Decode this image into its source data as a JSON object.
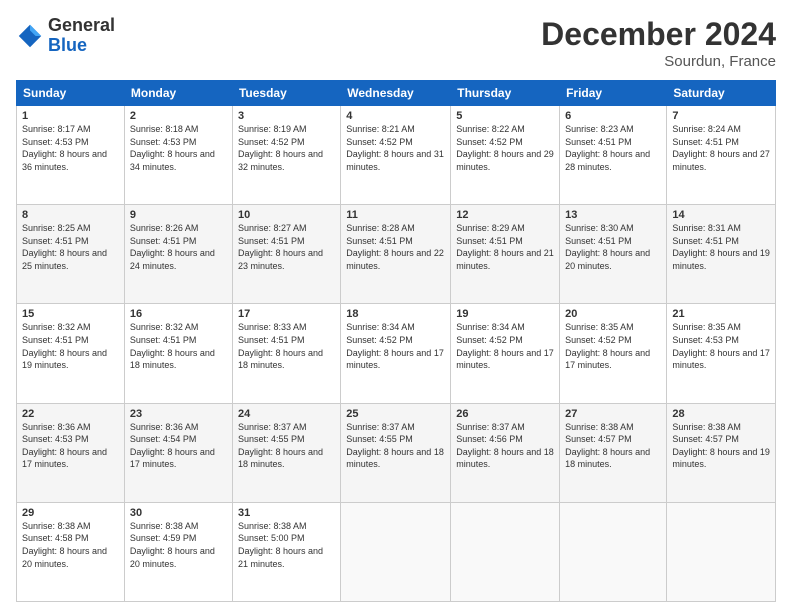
{
  "logo": {
    "general": "General",
    "blue": "Blue"
  },
  "title": "December 2024",
  "subtitle": "Sourdun, France",
  "calendar": {
    "headers": [
      "Sunday",
      "Monday",
      "Tuesday",
      "Wednesday",
      "Thursday",
      "Friday",
      "Saturday"
    ],
    "weeks": [
      [
        {
          "day": "1",
          "sunrise": "8:17 AM",
          "sunset": "4:53 PM",
          "daylight": "8 hours and 36 minutes."
        },
        {
          "day": "2",
          "sunrise": "8:18 AM",
          "sunset": "4:53 PM",
          "daylight": "8 hours and 34 minutes."
        },
        {
          "day": "3",
          "sunrise": "8:19 AM",
          "sunset": "4:52 PM",
          "daylight": "8 hours and 32 minutes."
        },
        {
          "day": "4",
          "sunrise": "8:21 AM",
          "sunset": "4:52 PM",
          "daylight": "8 hours and 31 minutes."
        },
        {
          "day": "5",
          "sunrise": "8:22 AM",
          "sunset": "4:52 PM",
          "daylight": "8 hours and 29 minutes."
        },
        {
          "day": "6",
          "sunrise": "8:23 AM",
          "sunset": "4:51 PM",
          "daylight": "8 hours and 28 minutes."
        },
        {
          "day": "7",
          "sunrise": "8:24 AM",
          "sunset": "4:51 PM",
          "daylight": "8 hours and 27 minutes."
        }
      ],
      [
        {
          "day": "8",
          "sunrise": "8:25 AM",
          "sunset": "4:51 PM",
          "daylight": "8 hours and 25 minutes."
        },
        {
          "day": "9",
          "sunrise": "8:26 AM",
          "sunset": "4:51 PM",
          "daylight": "8 hours and 24 minutes."
        },
        {
          "day": "10",
          "sunrise": "8:27 AM",
          "sunset": "4:51 PM",
          "daylight": "8 hours and 23 minutes."
        },
        {
          "day": "11",
          "sunrise": "8:28 AM",
          "sunset": "4:51 PM",
          "daylight": "8 hours and 22 minutes."
        },
        {
          "day": "12",
          "sunrise": "8:29 AM",
          "sunset": "4:51 PM",
          "daylight": "8 hours and 21 minutes."
        },
        {
          "day": "13",
          "sunrise": "8:30 AM",
          "sunset": "4:51 PM",
          "daylight": "8 hours and 20 minutes."
        },
        {
          "day": "14",
          "sunrise": "8:31 AM",
          "sunset": "4:51 PM",
          "daylight": "8 hours and 19 minutes."
        }
      ],
      [
        {
          "day": "15",
          "sunrise": "8:32 AM",
          "sunset": "4:51 PM",
          "daylight": "8 hours and 19 minutes."
        },
        {
          "day": "16",
          "sunrise": "8:32 AM",
          "sunset": "4:51 PM",
          "daylight": "8 hours and 18 minutes."
        },
        {
          "day": "17",
          "sunrise": "8:33 AM",
          "sunset": "4:51 PM",
          "daylight": "8 hours and 18 minutes."
        },
        {
          "day": "18",
          "sunrise": "8:34 AM",
          "sunset": "4:52 PM",
          "daylight": "8 hours and 17 minutes."
        },
        {
          "day": "19",
          "sunrise": "8:34 AM",
          "sunset": "4:52 PM",
          "daylight": "8 hours and 17 minutes."
        },
        {
          "day": "20",
          "sunrise": "8:35 AM",
          "sunset": "4:52 PM",
          "daylight": "8 hours and 17 minutes."
        },
        {
          "day": "21",
          "sunrise": "8:35 AM",
          "sunset": "4:53 PM",
          "daylight": "8 hours and 17 minutes."
        }
      ],
      [
        {
          "day": "22",
          "sunrise": "8:36 AM",
          "sunset": "4:53 PM",
          "daylight": "8 hours and 17 minutes."
        },
        {
          "day": "23",
          "sunrise": "8:36 AM",
          "sunset": "4:54 PM",
          "daylight": "8 hours and 17 minutes."
        },
        {
          "day": "24",
          "sunrise": "8:37 AM",
          "sunset": "4:55 PM",
          "daylight": "8 hours and 18 minutes."
        },
        {
          "day": "25",
          "sunrise": "8:37 AM",
          "sunset": "4:55 PM",
          "daylight": "8 hours and 18 minutes."
        },
        {
          "day": "26",
          "sunrise": "8:37 AM",
          "sunset": "4:56 PM",
          "daylight": "8 hours and 18 minutes."
        },
        {
          "day": "27",
          "sunrise": "8:38 AM",
          "sunset": "4:57 PM",
          "daylight": "8 hours and 18 minutes."
        },
        {
          "day": "28",
          "sunrise": "8:38 AM",
          "sunset": "4:57 PM",
          "daylight": "8 hours and 19 minutes."
        }
      ],
      [
        {
          "day": "29",
          "sunrise": "8:38 AM",
          "sunset": "4:58 PM",
          "daylight": "8 hours and 20 minutes."
        },
        {
          "day": "30",
          "sunrise": "8:38 AM",
          "sunset": "4:59 PM",
          "daylight": "8 hours and 20 minutes."
        },
        {
          "day": "31",
          "sunrise": "8:38 AM",
          "sunset": "5:00 PM",
          "daylight": "8 hours and 21 minutes."
        },
        null,
        null,
        null,
        null
      ]
    ]
  }
}
